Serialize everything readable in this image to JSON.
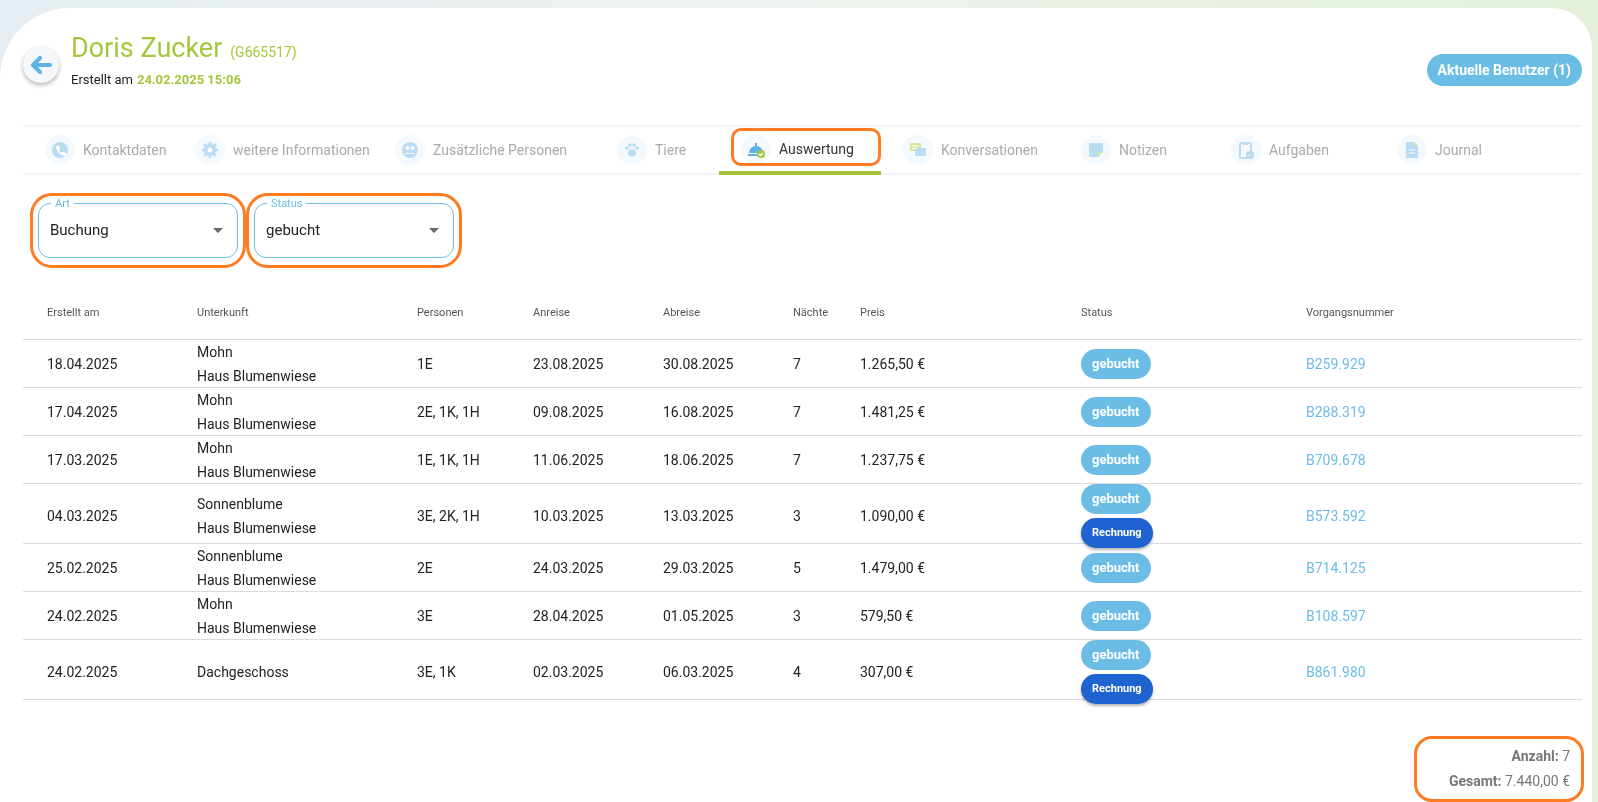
{
  "header": {
    "name": "Doris Zucker",
    "code": "(G665517)",
    "created_label": "Erstellt am",
    "created_value": "24.02.2025 15:06",
    "users_button": "Aktuelle Benutzer (1)"
  },
  "tabs": [
    {
      "label": "Kontaktdaten",
      "selected": false,
      "highlighted": false
    },
    {
      "label": "weitere Informationen",
      "selected": false,
      "highlighted": false
    },
    {
      "label": "Zusätzliche Personen",
      "selected": false,
      "highlighted": false
    },
    {
      "label": "Tiere",
      "selected": false,
      "highlighted": false
    },
    {
      "label": "Auswertung",
      "selected": true,
      "highlighted": true
    },
    {
      "label": "Konversationen",
      "selected": false,
      "highlighted": false
    },
    {
      "label": "Notizen",
      "selected": false,
      "highlighted": false
    },
    {
      "label": "Aufgaben",
      "selected": false,
      "highlighted": false
    },
    {
      "label": "Journal",
      "selected": false,
      "highlighted": false
    }
  ],
  "filters": [
    {
      "label": "Art",
      "value": "Buchung",
      "highlighted": true
    },
    {
      "label": "Status",
      "value": "gebucht",
      "highlighted": true
    }
  ],
  "table": {
    "columns": [
      "Erstellt am",
      "Unterkunft",
      "Personen",
      "Anreise",
      "Abreise",
      "Nächte",
      "Preis",
      "Status",
      "Vorgangsnummer"
    ],
    "rows": [
      {
        "created": "18.04.2025",
        "unit": [
          "Mohn",
          "Haus Blumenwiese"
        ],
        "persons": "1E",
        "arrival": "23.08.2025",
        "departure": "30.08.2025",
        "nights": "7",
        "price": "1.265,50 €",
        "badges": [
          {
            "label": "gebucht",
            "kind": "booked"
          }
        ],
        "number": "B259.929"
      },
      {
        "created": "17.04.2025",
        "unit": [
          "Mohn",
          "Haus Blumenwiese"
        ],
        "persons": "2E, 1K, 1H",
        "arrival": "09.08.2025",
        "departure": "16.08.2025",
        "nights": "7",
        "price": "1.481,25 €",
        "badges": [
          {
            "label": "gebucht",
            "kind": "booked"
          }
        ],
        "number": "B288.319"
      },
      {
        "created": "17.03.2025",
        "unit": [
          "Mohn",
          "Haus Blumenwiese"
        ],
        "persons": "1E, 1K, 1H",
        "arrival": "11.06.2025",
        "departure": "18.06.2025",
        "nights": "7",
        "price": "1.237,75 €",
        "badges": [
          {
            "label": "gebucht",
            "kind": "booked"
          }
        ],
        "number": "B709.678"
      },
      {
        "created": "04.03.2025",
        "unit": [
          "Sonnenblume",
          "Haus Blumenwiese"
        ],
        "persons": "3E, 2K, 1H",
        "arrival": "10.03.2025",
        "departure": "13.03.2025",
        "nights": "3",
        "price": "1.090,00 €",
        "badges": [
          {
            "label": "gebucht",
            "kind": "booked"
          },
          {
            "label": "Rechnung",
            "kind": "invoice"
          }
        ],
        "number": "B573.592"
      },
      {
        "created": "25.02.2025",
        "unit": [
          "Sonnenblume",
          "Haus Blumenwiese"
        ],
        "persons": "2E",
        "arrival": "24.03.2025",
        "departure": "29.03.2025",
        "nights": "5",
        "price": "1.479,00 €",
        "badges": [
          {
            "label": "gebucht",
            "kind": "booked"
          }
        ],
        "number": "B714.125"
      },
      {
        "created": "24.02.2025",
        "unit": [
          "Mohn",
          "Haus Blumenwiese"
        ],
        "persons": "3E",
        "arrival": "28.04.2025",
        "departure": "01.05.2025",
        "nights": "3",
        "price": "579,50 €",
        "badges": [
          {
            "label": "gebucht",
            "kind": "booked"
          }
        ],
        "number": "B108.597"
      },
      {
        "created": "24.02.2025",
        "unit": [
          "Dachgeschoss"
        ],
        "persons": "3E, 1K",
        "arrival": "02.03.2025",
        "departure": "06.03.2025",
        "nights": "4",
        "price": "307,00 €",
        "badges": [
          {
            "label": "gebucht",
            "kind": "booked"
          },
          {
            "label": "Rechnung",
            "kind": "invoice"
          }
        ],
        "number": "B861.980"
      }
    ]
  },
  "summary": {
    "highlighted": true,
    "items": [
      {
        "label": "Anzahl:",
        "value": "7"
      },
      {
        "label": "Gesamt:",
        "value": "7.440,00 €"
      }
    ]
  }
}
